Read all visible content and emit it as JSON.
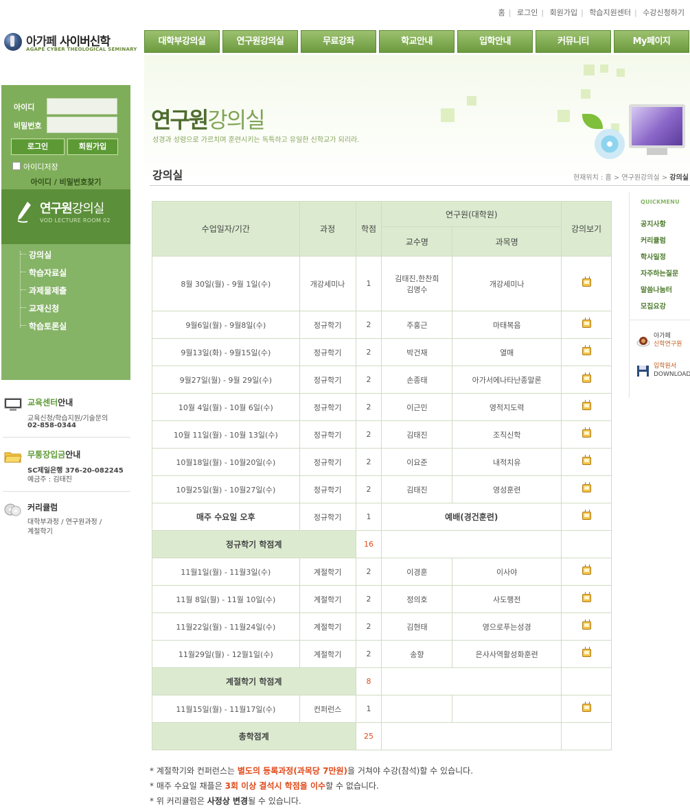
{
  "top_links": [
    "홈",
    "로그인",
    "회원가입",
    "학습지원센터",
    "수강신청하기"
  ],
  "logo": {
    "name_part1": "아가페 ",
    "name_part2": "사이버신학",
    "english": "AGAPE CYBER THEOLOGICAL SEMINARY"
  },
  "gnb": [
    "대학부강의실",
    "연구원강의실",
    "무료강좌",
    "학교안내",
    "입학안내",
    "커뮤니티",
    "My페이지"
  ],
  "login": {
    "id_label": "아이디",
    "pw_label": "비밀번호",
    "login_button": "로그인",
    "join_button": "회원가입",
    "save_id": "아이디저장",
    "find": "아이디 / 비밀번호찾기"
  },
  "lnb": {
    "title_bold": "연구원",
    "title_light": "강의실",
    "subtitle": "VOD LECTURE ROOM 02",
    "items": [
      "강의실",
      "학습자료실",
      "과제물제출",
      "교재신청",
      "학습토론실"
    ]
  },
  "info": {
    "edu_title_green": "교육센터",
    "edu_title_rest": "안내",
    "edu_line1": "교육신청/학습지원/기술문의",
    "edu_line2": "02-858-0344",
    "bank_title_green": "무통장입금",
    "bank_title_rest": "안내",
    "bank_line1": "SC제일은행 376-20-082245",
    "bank_line2": "예금주 : 김태진",
    "curr_title": "커리큘럼",
    "curr_line1": "대학부과정 / 연구원과정 /",
    "curr_line2": "계절학기"
  },
  "header": {
    "title_bold": "연구원",
    "title_light": "강의실",
    "subtitle": "성경과 성령으로 가르치며 훈련시키는 독특하고 유일한 신학교가 되리라.",
    "section": "강의실",
    "breadcrumb_prefix": "현재위치 : 홈 > 연구원강의실 > ",
    "breadcrumb_current": "강의실"
  },
  "table": {
    "headers": {
      "period": "수업일자/기간",
      "course": "과정",
      "credit": "학점",
      "group": "연구원(대학원)",
      "professor": "교수명",
      "subject": "과목명",
      "watch": "강의보기"
    },
    "rows_a": [
      {
        "period": "8월 30일(월) - 9월 1일(수)",
        "course": "개강세미나",
        "credit": "1",
        "professor_1": "김태진,한찬희",
        "professor_2": "김명수",
        "subject": "개강세미나"
      },
      {
        "period": "9월6일(월) - 9월8일(수)",
        "course": "정규학기",
        "credit": "2",
        "professor": "주홍근",
        "subject": "마태복음"
      },
      {
        "period": "9월13일(화) - 9월15일(수)",
        "course": "정규학기",
        "credit": "2",
        "professor": "박건재",
        "subject": "열매"
      },
      {
        "period": "9월27일(월) - 9월 29일(수)",
        "course": "정규학기",
        "credit": "2",
        "professor": "손종태",
        "subject": "아가서에나타난종말론"
      },
      {
        "period": "10월 4일(월) - 10월 6일(수)",
        "course": "정규학기",
        "credit": "2",
        "professor": "이근민",
        "subject": "영적지도력"
      },
      {
        "period": "10월 11일(월) - 10월 13일(수)",
        "course": "정규학기",
        "credit": "2",
        "professor": "김태진",
        "subject": "조직신학"
      },
      {
        "period": "10월18일(월) - 10월20일(수)",
        "course": "정규학기",
        "credit": "2",
        "professor": "이요준",
        "subject": "내적치유"
      },
      {
        "period": "10월25일(월) - 10월27일(수)",
        "course": "정규학기",
        "credit": "2",
        "professor": "김태진",
        "subject": "영성훈련"
      }
    ],
    "worship": {
      "period": "매주 수요일 오후",
      "course": "정규학기",
      "credit": "1",
      "subject": "예배(경건훈련)"
    },
    "regular_total": {
      "label": "정규학기 학점계",
      "value": "16"
    },
    "rows_b": [
      {
        "period": "11월1일(월) - 11월3일(수)",
        "course": "계절학기",
        "credit": "2",
        "professor": "이경훈",
        "subject": "이사야"
      },
      {
        "period": "11월 8일(월) - 11월 10일(수)",
        "course": "계절학기",
        "credit": "2",
        "professor": "정의호",
        "subject": "사도행전"
      },
      {
        "period": "11월22일(월) - 11월24일(수)",
        "course": "계절학기",
        "credit": "2",
        "professor": "김현태",
        "subject": "영으로푸는성경"
      },
      {
        "period": "11월29일(월) - 12월1일(수)",
        "course": "계절학기",
        "credit": "2",
        "professor": "송향",
        "subject": "은사사역활성화훈련"
      }
    ],
    "season_total": {
      "label": "계절학기 학점계",
      "value": "8"
    },
    "conference": {
      "period": "11월15일(월) - 11월17일(수)",
      "course": "컨퍼런스",
      "credit": "1"
    },
    "grand_total": {
      "label": "총학점계",
      "value": "25"
    }
  },
  "quick": {
    "title_1": "QUICK",
    "title_2": "MENU",
    "items": [
      "공지사항",
      "커리큘럼",
      "학사일정",
      "자주하는질문",
      "말씀나눔터",
      "모집요강"
    ],
    "link1_line1": "아가페",
    "link1_line2": "신학연구원",
    "link2_line1": "입학원서",
    "link2_line2": "DOWNLOAD"
  },
  "notes": {
    "n1_a": "* 계절학기와 컨퍼런스는 ",
    "n1_b": "별도의 등록과정(과목당 7만원)",
    "n1_c": "을 거쳐야 수강(참석)할 수 있습니다.",
    "n2_a": "* 매주 수요일 채플은 ",
    "n2_b": "3회 이상 결석시 학점을 이수",
    "n2_c": "할 수 없습니다.",
    "n3_a": "* 위 커리큘럼은 ",
    "n3_b": "사정상 변경",
    "n3_c": "될 수 있습니다."
  },
  "colors": {
    "brand_green": "#7fae5a",
    "dark_green": "#5b8f3a",
    "header_cell": "#dcebd0",
    "accent_red": "#e04818",
    "nav_green": "#6c9a3e"
  },
  "icons": [
    "globe-logo-icon",
    "pen-icon",
    "monitor-icon",
    "folder-icon",
    "cd-icon",
    "tv-icon",
    "coffee-icon",
    "floppy-icon",
    "disc-icon"
  ]
}
